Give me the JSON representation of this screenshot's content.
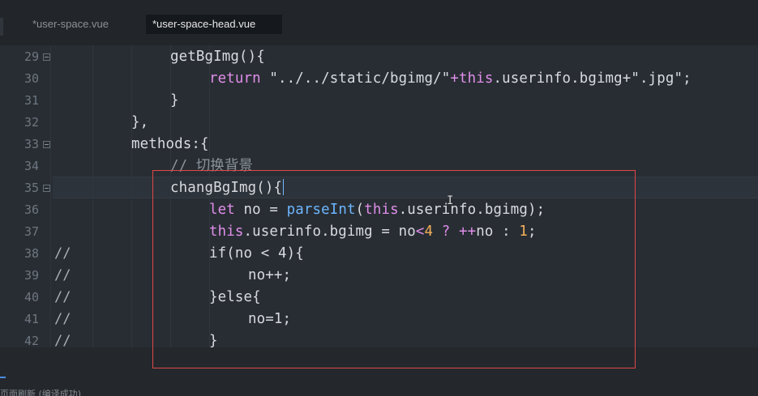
{
  "tabs": [
    {
      "label": "*user-space.vue",
      "active": false
    },
    {
      "label": "*user-space-head.vue",
      "active": true
    }
  ],
  "editor": {
    "lines": [
      {
        "number": "29",
        "fold": true,
        "comment_prefix": "",
        "tokens": [
          "getBgImg(){"
        ]
      },
      {
        "number": "30",
        "fold": false,
        "comment_prefix": "",
        "tokens": [
          "return",
          "\"../../static/bgimg/\"",
          "+",
          "this",
          ".userinfo.bgimg+",
          "\".jpg\"",
          ";"
        ]
      },
      {
        "number": "31",
        "fold": false,
        "comment_prefix": "",
        "tokens": [
          "}"
        ]
      },
      {
        "number": "32",
        "fold": false,
        "comment_prefix": "",
        "tokens": [
          "},"
        ]
      },
      {
        "number": "33",
        "fold": true,
        "comment_prefix": "",
        "tokens": [
          "methods:{"
        ]
      },
      {
        "number": "34",
        "fold": false,
        "comment_prefix": "",
        "tokens": [
          "// 切换背景"
        ]
      },
      {
        "number": "35",
        "fold": true,
        "comment_prefix": "",
        "tokens": [
          "changBgImg(){"
        ]
      },
      {
        "number": "36",
        "fold": false,
        "comment_prefix": "",
        "tokens": [
          "let",
          "no = ",
          "parseInt",
          "(",
          "this",
          ".userinfo.bgimg);"
        ]
      },
      {
        "number": "37",
        "fold": false,
        "comment_prefix": "",
        "tokens": [
          "this",
          ".userinfo.bgimg = no",
          "<",
          "4",
          " ? ",
          "++",
          "no : ",
          "1",
          ";"
        ]
      },
      {
        "number": "38",
        "fold": false,
        "comment_prefix": "//",
        "tokens": [
          "if(no < 4){"
        ]
      },
      {
        "number": "39",
        "fold": false,
        "comment_prefix": "//",
        "tokens": [
          "no++;"
        ]
      },
      {
        "number": "40",
        "fold": false,
        "comment_prefix": "//",
        "tokens": [
          "}else{"
        ]
      },
      {
        "number": "41",
        "fold": false,
        "comment_prefix": "//",
        "tokens": [
          "no=1;"
        ]
      },
      {
        "number": "42",
        "fold": false,
        "comment_prefix": "//",
        "tokens": [
          "}"
        ]
      }
    ]
  },
  "console": {
    "text": "页面刷新 (编译成功)"
  },
  "colors": {
    "background": "#282d33",
    "keyword": "#e08ee9",
    "function": "#6cb6ff",
    "number": "#f5b05a",
    "comment": "#8b939b",
    "highlight_box": "#e14848"
  }
}
